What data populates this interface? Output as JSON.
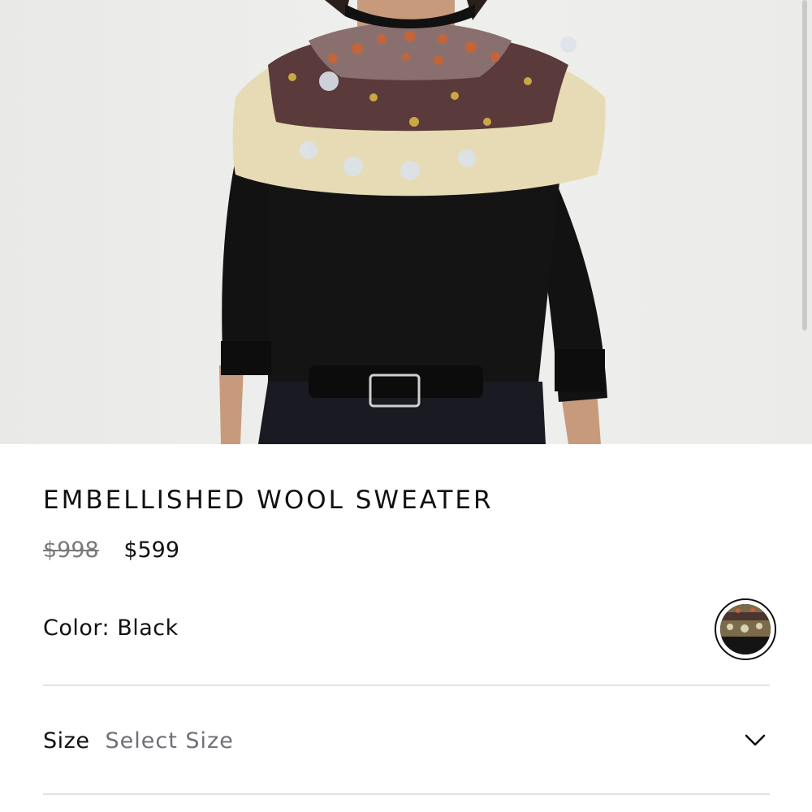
{
  "product": {
    "title": "EMBELLISHED WOOL SWEATER",
    "price_original": "$998",
    "price_sale": "$599",
    "color_label": "Color:",
    "color_value": "Black",
    "size_label": "Size",
    "size_placeholder": "Select Size"
  },
  "icons": {
    "size_dropdown": "chevron-down-icon",
    "color_swatch": "color-swatch"
  },
  "colors": {
    "text": "#111111",
    "muted_price": "#7a7a7a",
    "placeholder": "#6f7078",
    "divider": "#e2e2e2",
    "background": "#ffffff"
  }
}
